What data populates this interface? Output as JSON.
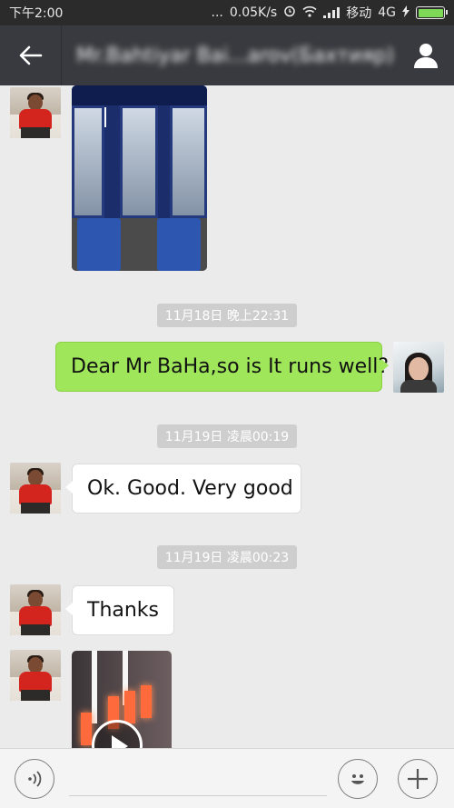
{
  "status_bar": {
    "time": "下午2:00",
    "dots": "...",
    "network_speed": "0.05K/s",
    "carrier": "移动",
    "network_type": "4G",
    "battery_color": "#7ed957"
  },
  "header": {
    "title": "Mr.Bahtiyar Bai...arov(Бахтияр)",
    "back_icon": "arrow-left-icon",
    "profile_icon": "person-icon"
  },
  "messages": [
    {
      "type": "image",
      "sender": "them",
      "content": "paint-booth-photo"
    },
    {
      "type": "timestamp",
      "text": "11月18日 晚上22:31"
    },
    {
      "type": "text",
      "sender": "me",
      "text": "Dear Mr BaHa,so is It runs well?"
    },
    {
      "type": "timestamp",
      "text": "11月19日 凌晨00:19"
    },
    {
      "type": "text",
      "sender": "them",
      "text": "Ok. Good. Very good"
    },
    {
      "type": "timestamp",
      "text": "11月19日 凌晨00:23"
    },
    {
      "type": "text",
      "sender": "them",
      "text": "Thanks"
    },
    {
      "type": "video",
      "sender": "them",
      "content": "infrared-heater-video"
    }
  ],
  "input_bar": {
    "voice_icon": "voice-icon",
    "emoji_icon": "emoji-icon",
    "plus_icon": "plus-icon",
    "placeholder": ""
  },
  "colors": {
    "outgoing_bubble": "#9fe65a",
    "incoming_bubble": "#ffffff",
    "header_bg": "#393a3f",
    "chat_bg": "#ebebeb"
  }
}
